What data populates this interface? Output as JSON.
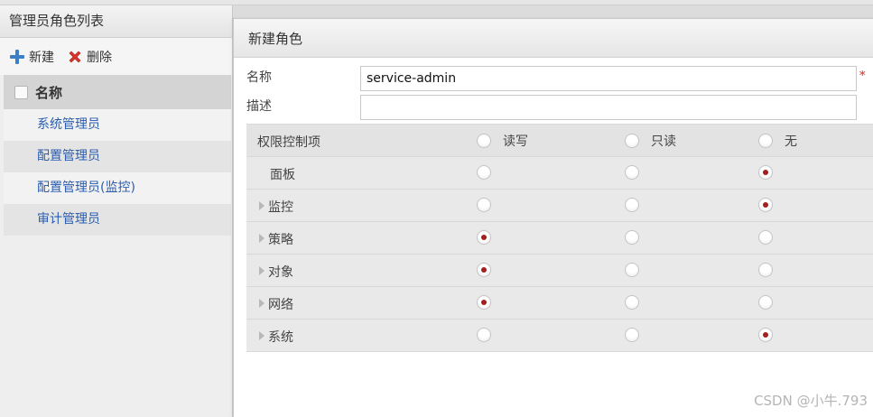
{
  "left_panel": {
    "title": "管理员角色列表",
    "toolbar": {
      "new_label": "新建",
      "delete_label": "删除"
    },
    "column_header": "名称",
    "roles": [
      "系统管理员",
      "配置管理员",
      "配置管理员(监控)",
      "审计管理员"
    ]
  },
  "dialog": {
    "title": "新建角色",
    "name_label": "名称",
    "name_value": "service-admin",
    "required_mark": "*",
    "desc_label": "描述",
    "desc_value": "",
    "permissions": {
      "header": {
        "name": "权限控制项",
        "read_write": "读写",
        "read_only": "只读",
        "none": "无"
      },
      "rows": [
        {
          "name": "面板",
          "expandable": false,
          "selected": "none"
        },
        {
          "name": "监控",
          "expandable": true,
          "selected": "none"
        },
        {
          "name": "策略",
          "expandable": true,
          "selected": "read_write"
        },
        {
          "name": "对象",
          "expandable": true,
          "selected": "read_write"
        },
        {
          "name": "网络",
          "expandable": true,
          "selected": "read_write"
        },
        {
          "name": "系统",
          "expandable": true,
          "selected": "none"
        }
      ]
    }
  },
  "watermark": "CSDN @小牛.793",
  "colors": {
    "link": "#2a5db0",
    "radio_checked": "#a31e1e",
    "required": "#dd2222"
  },
  "icons": {
    "new": "plus-icon",
    "delete": "red-x-icon",
    "expand": "triangle-right-icon"
  }
}
